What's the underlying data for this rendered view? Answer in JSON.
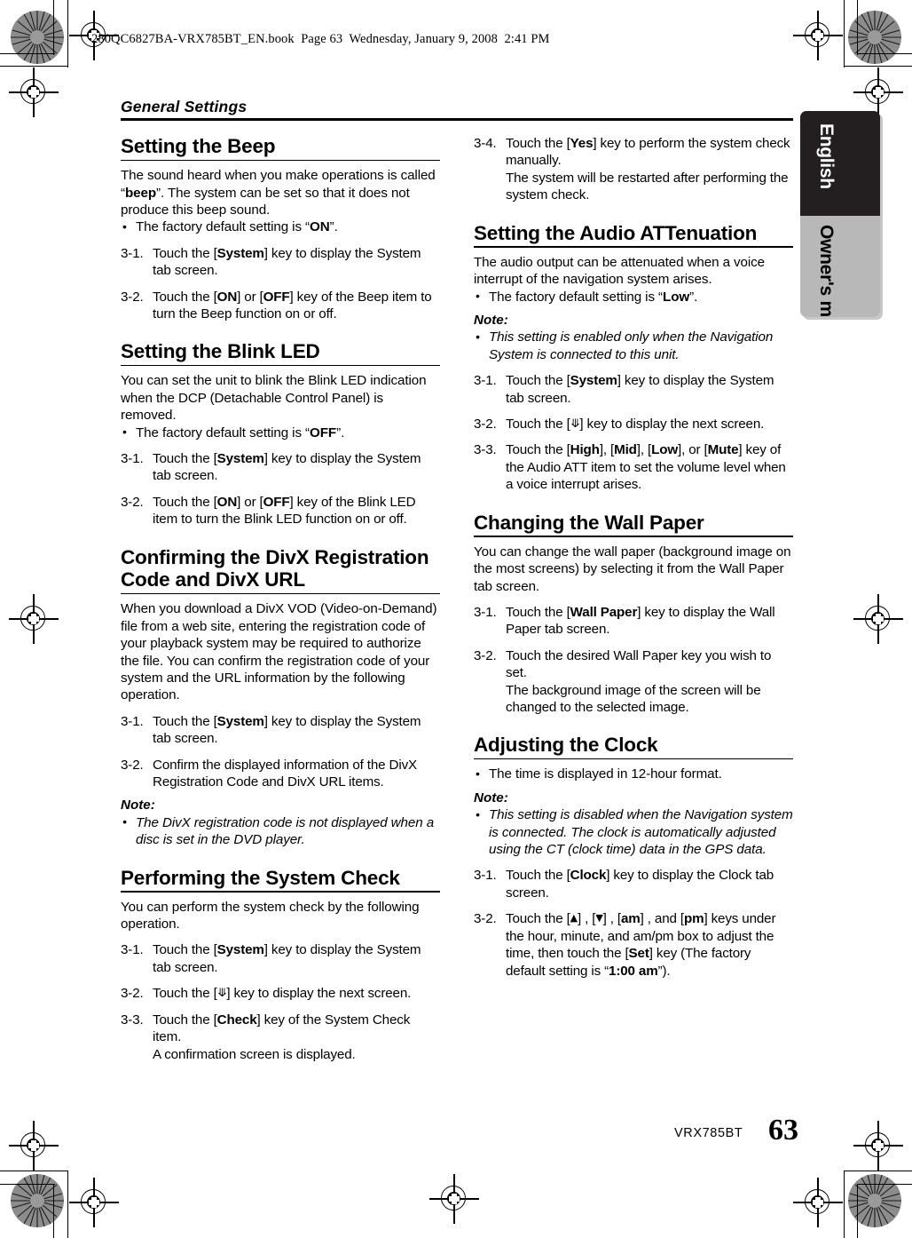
{
  "print_header": {
    "book_line": "280QC6827BA-VRX785BT_EN.book  Page 63  Wednesday, January 9, 2008  2:41 PM"
  },
  "running_head": {
    "title": "General Settings"
  },
  "side_tab": {
    "language": "English",
    "manual_type": "Owner's manual"
  },
  "footer": {
    "model": "VRX785BT",
    "page_number": "63"
  },
  "left_column": {
    "s1": {
      "heading": "Setting the Beep",
      "intro_1": "The sound heard when you make operations is called “",
      "intro_bold": "beep",
      "intro_2": "”. The system can be set so that it does not produce this beep sound.",
      "bullet_1a": "The factory default setting is “",
      "bullet_1b": "ON",
      "bullet_1c": "”.",
      "step1_num": "3-1.",
      "step1_a": "Touch the [",
      "step1_key": "System",
      "step1_b": "] key to display the System tab screen.",
      "step2_num": "3-2.",
      "step2_a": "Touch the [",
      "step2_key1": "ON",
      "step2_b": "] or [",
      "step2_key2": "OFF",
      "step2_c": "] key of the Beep item to turn the Beep function on or off."
    },
    "s2": {
      "heading": "Setting the Blink LED",
      "intro": "You can set the unit to blink the Blink LED indication when the DCP (Detachable Control Panel) is removed.",
      "bullet_1a": "The factory default setting is “",
      "bullet_1b": "OFF",
      "bullet_1c": "”.",
      "step1_num": "3-1.",
      "step1_a": "Touch the [",
      "step1_key": "System",
      "step1_b": "] key to display the System tab screen.",
      "step2_num": "3-2.",
      "step2_a": "Touch the [",
      "step2_key1": "ON",
      "step2_b": "] or [",
      "step2_key2": "OFF",
      "step2_c": "] key of the Blink LED item to turn the Blink LED function on or off."
    },
    "s3": {
      "heading": "Confirming the DivX Registration Code and DivX URL",
      "intro": "When you download a DivX VOD (Video-on-Demand) file from a web site, entering the registration code of your playback system may be required to authorize the file. You can confirm the registration code of your system and the URL information by the following operation.",
      "step1_num": "3-1.",
      "step1_a": "Touch the [",
      "step1_key": "System",
      "step1_b": "] key to display the System tab screen.",
      "step2_num": "3-2.",
      "step2_text": "Confirm the displayed information of the DivX Registration Code and DivX URL items.",
      "note_label": "Note:",
      "note_1": "The DivX registration code is not displayed when a disc is set in the DVD player."
    },
    "s4": {
      "heading": "Performing the System Check",
      "intro": "You can perform the system check by the following operation.",
      "step1_num": "3-1.",
      "step1_a": "Touch the [",
      "step1_key": "System",
      "step1_b": "] key to display the System tab screen.",
      "step2_num": "3-2.",
      "step2_a": "Touch the [",
      "step2_icon": "chevron-double-down",
      "step2_b": "] key to display the next screen.",
      "step3_num": "3-3.",
      "step3_a": "Touch the [",
      "step3_key": "Check",
      "step3_b": "] key of the System Check item.",
      "step3_c": "A confirmation screen is displayed."
    }
  },
  "right_column": {
    "s5": {
      "step4_num": "3-4.",
      "step4_a": "Touch the [",
      "step4_key": "Yes",
      "step4_b": "] key to perform the system check manually.",
      "step4_c": "The system will be restarted after performing the system check."
    },
    "s6": {
      "heading": "Setting the Audio ATTenuation",
      "intro": "The audio output can be attenuated when a voice interrupt of the navigation system arises.",
      "bullet_1a": "The factory default setting is “",
      "bullet_1b": "Low",
      "bullet_1c": "”.",
      "note_label": "Note:",
      "note_1": "This setting is enabled only when the Navigation System is connected to this unit.",
      "step1_num": "3-1.",
      "step1_a": "Touch the [",
      "step1_key": "System",
      "step1_b": "] key to display the System tab screen.",
      "step2_num": "3-2.",
      "step2_a": "Touch the [",
      "step2_icon": "chevron-double-down",
      "step2_b": "] key to display the next screen.",
      "step3_num": "3-3.",
      "step3_a": "Touch the [",
      "step3_key1": "High",
      "step3_b": "], [",
      "step3_key2": "Mid",
      "step3_c": "], [",
      "step3_key3": "Low",
      "step3_d": "], or [",
      "step3_key4": "Mute",
      "step3_e": "] key of the Audio ATT item to set the volume level when a voice interrupt arises."
    },
    "s7": {
      "heading": "Changing the Wall Paper",
      "intro": "You can change the wall paper (background image on the most screens) by selecting it from the Wall Paper tab screen.",
      "step1_num": "3-1.",
      "step1_a": "Touch the [",
      "step1_key": "Wall Paper",
      "step1_b": "] key to display the Wall Paper tab screen.",
      "step2_num": "3-2.",
      "step2_a": "Touch the desired Wall Paper key you wish to set.",
      "step2_b": "The background image of the screen will be changed to the selected image."
    },
    "s8": {
      "heading": "Adjusting the Clock",
      "bullet_1": "The time is displayed in 12-hour format.",
      "note_label": "Note:",
      "note_1": "This setting is disabled when the Navigation system is connected. The clock is automatically adjusted using the CT (clock time) data in the GPS data.",
      "step1_num": "3-1.",
      "step1_a": "Touch the [",
      "step1_key": "Clock",
      "step1_b": "] key to display the Clock tab screen.",
      "step2_num": "3-2.",
      "step2_a": "Touch the [",
      "step2_icon_up": "triangle-up",
      "step2_b": "] , [",
      "step2_icon_down": "triangle-down",
      "step2_c": "] , [",
      "step2_key_am": "am",
      "step2_d": "] , and [",
      "step2_key_pm": "pm",
      "step2_e": "] keys under the hour, minute, and am/pm box to adjust the time, then touch the [",
      "step2_key_set": "Set",
      "step2_f": "] key (The factory default setting is “",
      "step2_default": "1:00 am",
      "step2_g": "”)."
    }
  }
}
